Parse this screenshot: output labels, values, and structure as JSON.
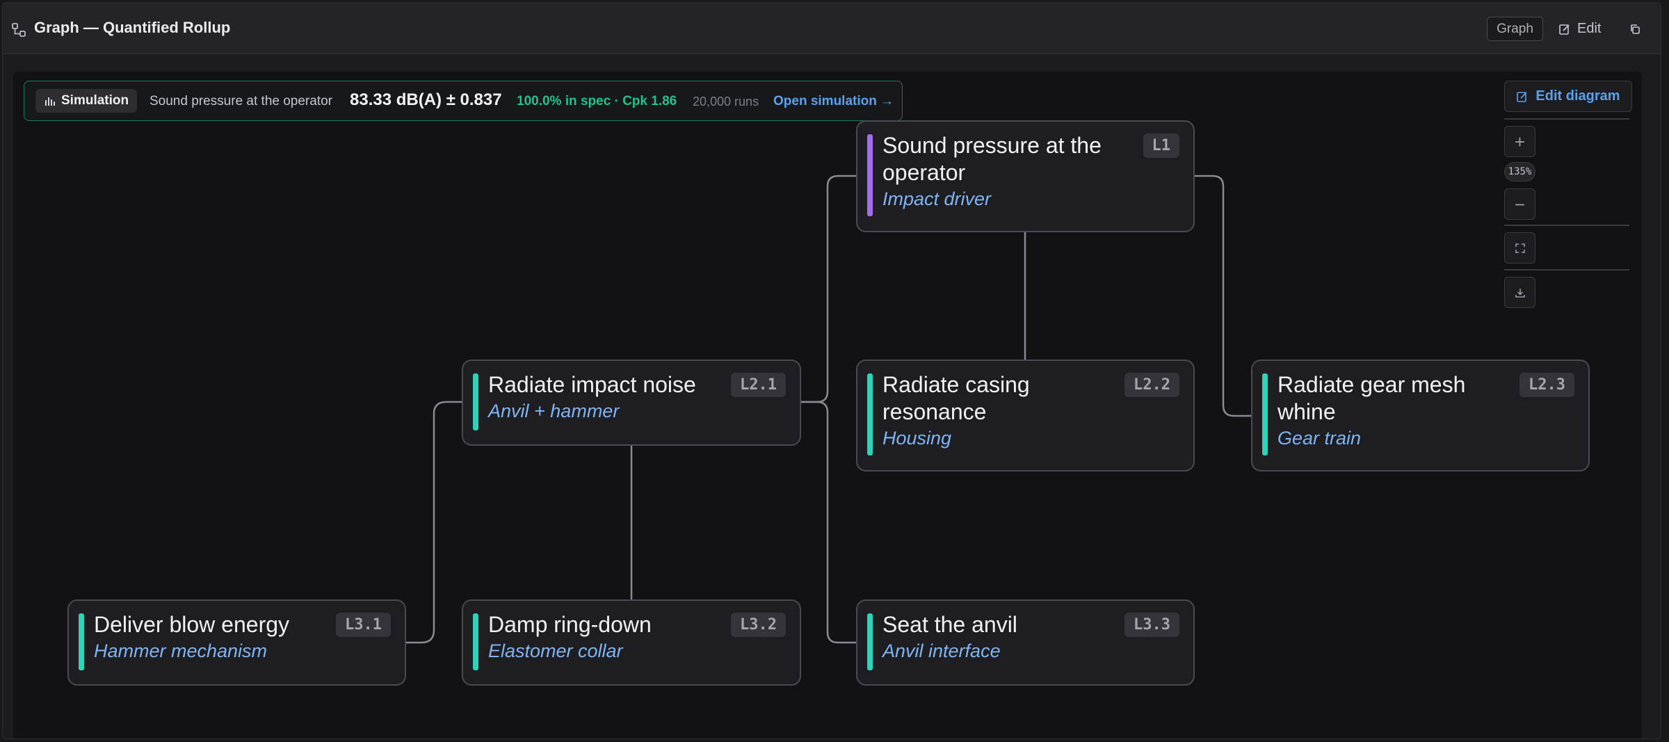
{
  "header": {
    "title": "Graph — Quantified Rollup",
    "graph_label": "Graph",
    "edit_label": "Edit"
  },
  "simulation": {
    "tag": "Simulation",
    "metric": "Sound pressure at the operator",
    "value": "83.33 dB(A) ± 0.837",
    "spec": "100.0% in spec · Cpk 1.86",
    "runs": "20,000 runs",
    "link": "Open simulation →"
  },
  "controls": {
    "edit_diagram": "Edit diagram",
    "zoom": "135%"
  },
  "nodes": {
    "l1": {
      "title": "Sound pressure at the operator",
      "subtitle": "Impact driver",
      "id": "L1",
      "accent": "#a36ee8"
    },
    "l21": {
      "title": "Radiate impact noise",
      "subtitle": "Anvil + hammer",
      "id": "L2.1",
      "accent": "#2dd4b8"
    },
    "l22": {
      "title": "Radiate casing resonance",
      "subtitle": "Housing",
      "id": "L2.2",
      "accent": "#2dd4b8"
    },
    "l23": {
      "title": "Radiate gear mesh whine",
      "subtitle": "Gear train",
      "id": "L2.3",
      "accent": "#2dd4b8"
    },
    "l31": {
      "title": "Deliver blow energy",
      "subtitle": "Hammer mechanism",
      "id": "L3.1",
      "accent": "#2dd4b8"
    },
    "l32": {
      "title": "Damp ring-down",
      "subtitle": "Elastomer collar",
      "id": "L3.2",
      "accent": "#2dd4b8"
    },
    "l33": {
      "title": "Seat the anvil",
      "subtitle": "Anvil interface",
      "id": "L3.3",
      "accent": "#2dd4b8"
    }
  },
  "colors": {
    "accent_link": "#5ba2ee",
    "spec_ok": "#22c38a",
    "edge": "#8a8a94"
  }
}
